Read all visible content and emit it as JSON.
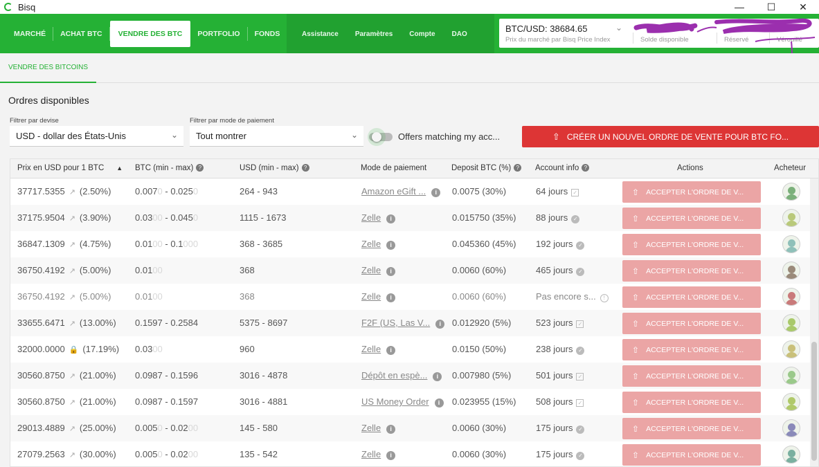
{
  "window": {
    "title": "Bisq",
    "minimize": "—",
    "maximize": "☐",
    "close": "✕"
  },
  "nav": {
    "left": [
      "MARCHÉ",
      "ACHAT BTC",
      "VENDRE DES BTC",
      "PORTFOLIO",
      "FONDS"
    ],
    "active": "VENDRE DES BTC",
    "middle": [
      "Assistance",
      "Paramètres",
      "Compte",
      "DAO"
    ]
  },
  "market": {
    "price": "BTC/USD: 38684.65",
    "price_caption": "Prix du marché par Bisq Price Index",
    "available_label": "Solde disponible",
    "reserved_label": "Réservé",
    "locked_label": "Vérouillé"
  },
  "subtab": "VENDRE DES BITCOINS",
  "section_title": "Ordres disponibles",
  "filters": {
    "currency_label": "Filtrer par devise",
    "currency_value": "USD  -  dollar des États-Unis",
    "payment_label": "Filtrer par mode de paiement",
    "payment_value": "Tout montrer",
    "matching_label": "Offers matching my acc..."
  },
  "create_button": "CRÉER UN NOUVEL ORDRE DE VENTE POUR BTC FO...",
  "table": {
    "headers": {
      "price": "Prix en USD pour 1 BTC",
      "btc": "BTC (min - max)",
      "usd": "USD (min - max)",
      "payment": "Mode de paiement",
      "deposit": "Deposit BTC (%)",
      "account": "Account info",
      "actions": "Actions",
      "buyer": "Acheteur"
    },
    "accept_label": "ACCEPTER L'ORDRE DE V...",
    "rows": [
      {
        "price": "37717.5355",
        "pct": "(2.50%)",
        "btc_min": "0.007",
        "btc_min_f": "0",
        "btc_max": "0.025",
        "btc_max_f": "0",
        "usd": "264 - 943",
        "payment": "Amazon eGift ...",
        "deposit": "0.0075 (30%)",
        "account": "64 jours",
        "badge": "square",
        "dim": false,
        "avatar": "#7bb07b"
      },
      {
        "price": "37175.9504",
        "pct": "(3.90%)",
        "btc_min": "0.03",
        "btc_min_f": "00",
        "btc_max": "0.045",
        "btc_max_f": "0",
        "usd": "1115 - 1673",
        "payment": "Zelle",
        "deposit": "0.015750 (35%)",
        "account": "88 jours",
        "badge": "check",
        "dim": false,
        "avatar": "#b9c97a"
      },
      {
        "price": "36847.1309",
        "pct": "(4.75%)",
        "btc_min": "0.01",
        "btc_min_f": "00",
        "btc_max": "0.1",
        "btc_max_f": "000",
        "usd": "368 - 3685",
        "payment": "Zelle",
        "deposit": "0.045360 (45%)",
        "account": "192 jours",
        "badge": "check",
        "dim": false,
        "avatar": "#8fc0b9"
      },
      {
        "price": "36750.4192",
        "pct": "(5.00%)",
        "btc_min": "0.01",
        "btc_min_f": "00",
        "btc_max": "",
        "btc_max_f": "",
        "usd": "368",
        "payment": "Zelle",
        "deposit": "0.0060 (60%)",
        "account": "465 jours",
        "badge": "check",
        "dim": false,
        "avatar": "#9a8a7a"
      },
      {
        "price": "36750.4192",
        "pct": "(5.00%)",
        "btc_min": "0.01",
        "btc_min_f": "00",
        "btc_max": "",
        "btc_max_f": "",
        "usd": "368",
        "payment": "Zelle",
        "deposit": "0.0060 (60%)",
        "account": "Pas encore s...",
        "badge": "warn",
        "dim": true,
        "avatar": "#c97a7a"
      },
      {
        "price": "33655.6471",
        "pct": "(13.00%)",
        "btc_min": "0.1597",
        "btc_min_f": "",
        "btc_max": "0.2584",
        "btc_max_f": "",
        "usd": "5375 - 8697",
        "payment": "F2F (US, Las V...",
        "deposit": "0.012920 (5%)",
        "account": "523 jours",
        "badge": "square",
        "dim": false,
        "avatar": "#a9c96a"
      },
      {
        "price": "32000.0000",
        "pct": "(17.19%)",
        "btc_min": "0.03",
        "btc_min_f": "00",
        "btc_max": "",
        "btc_max_f": "",
        "usd": "960",
        "payment": "Zelle",
        "deposit": "0.0150 (50%)",
        "account": "238 jours",
        "badge": "check",
        "dim": false,
        "avatar": "#c9c07a",
        "locked": true
      },
      {
        "price": "30560.8750",
        "pct": "(21.00%)",
        "btc_min": "0.0987",
        "btc_min_f": "",
        "btc_max": "0.1596",
        "btc_max_f": "",
        "usd": "3016 - 4878",
        "payment": "Dépôt en espè...",
        "deposit": "0.007980 (5%)",
        "account": "501 jours",
        "badge": "square",
        "dim": false,
        "avatar": "#9ac98a"
      },
      {
        "price": "30560.8750",
        "pct": "(21.00%)",
        "btc_min": "0.0987",
        "btc_min_f": "",
        "btc_max": "0.1597",
        "btc_max_f": "",
        "usd": "3016 - 4881",
        "payment": "US Money Order",
        "deposit": "0.023955 (15%)",
        "account": "508 jours",
        "badge": "square",
        "dim": false,
        "avatar": "#b0c96a"
      },
      {
        "price": "29013.4889",
        "pct": "(25.00%)",
        "btc_min": "0.005",
        "btc_min_f": "0",
        "btc_max": "0.02",
        "btc_max_f": "00",
        "usd": "145 - 580",
        "payment": "Zelle",
        "deposit": "0.0060 (30%)",
        "account": "175 jours",
        "badge": "check",
        "dim": false,
        "avatar": "#8a8ab9"
      },
      {
        "price": "27079.2563",
        "pct": "(30.00%)",
        "btc_min": "0.005",
        "btc_min_f": "0",
        "btc_max": "0.02",
        "btc_max_f": "00",
        "usd": "135 - 542",
        "payment": "Zelle",
        "deposit": "0.0060 (30%)",
        "account": "175 jours",
        "badge": "check",
        "dim": false,
        "avatar": "#7ab0a0"
      }
    ]
  },
  "colors": {
    "brand_green": "#25b135",
    "create_red": "#dd3535",
    "accept_pink": "#eba5a5"
  }
}
